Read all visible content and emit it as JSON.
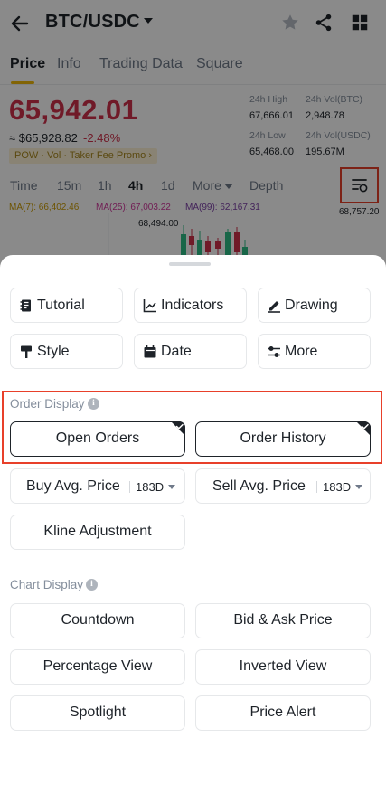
{
  "header": {
    "pair": "BTC/USDC"
  },
  "tabs": [
    "Price",
    "Info",
    "Trading Data",
    "Square"
  ],
  "price": {
    "last": "65,942.01",
    "usd": "≈ $65,928.82",
    "change": "-2.48%",
    "promo": "POW · Vol · Taker Fee Promo ›"
  },
  "stats": {
    "high_label": "24h High",
    "high_value": "67,666.01",
    "low_label": "24h Low",
    "low_value": "65,468.00",
    "vol_btc_label": "24h Vol(BTC)",
    "vol_btc_value": "2,948.78",
    "vol_usdc_label": "24h Vol(USDC)",
    "vol_usdc_value": "195.67M"
  },
  "intervals": [
    "Time",
    "15m",
    "1h",
    "4h",
    "1d",
    "More",
    "Depth"
  ],
  "active_interval": "4h",
  "chart": {
    "ma7": "MA(7): 66,402.46",
    "ma25": "MA(25): 67,003.22",
    "ma99": "MA(99): 62,167.31",
    "right_value": "68,757.20",
    "peak_value": "68,494.00"
  },
  "colors": {
    "up": "#2ebd85",
    "down": "#cf304a",
    "accent": "#f0b90b",
    "highlight": "#e8402a"
  },
  "sheet": {
    "tools": [
      {
        "label": "Tutorial",
        "icon": "book-icon"
      },
      {
        "label": "Indicators",
        "icon": "chart-line-icon"
      },
      {
        "label": "Drawing",
        "icon": "pen-icon"
      },
      {
        "label": "Style",
        "icon": "style-icon"
      },
      {
        "label": "Date",
        "icon": "calendar-icon"
      },
      {
        "label": "More",
        "icon": "sliders-icon"
      }
    ],
    "order_display": {
      "title": "Order Display",
      "open_orders": "Open Orders",
      "order_history": "Order History",
      "buy_avg_label": "Buy Avg. Price",
      "buy_avg_value": "183D",
      "sell_avg_label": "Sell Avg. Price",
      "sell_avg_value": "183D",
      "kline_adjustment": "Kline Adjustment"
    },
    "chart_display": {
      "title": "Chart Display",
      "items": [
        "Countdown",
        "Bid & Ask Price",
        "Percentage View",
        "Inverted View",
        "Spotlight",
        "Price Alert"
      ]
    }
  }
}
